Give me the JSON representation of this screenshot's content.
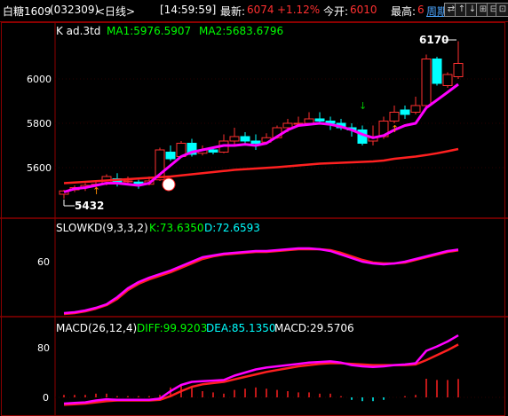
{
  "header": {
    "symbol_name": "白糖1609",
    "symbol_code": "(032309)",
    "period": "<日线>",
    "time": "[14:59:59]",
    "latest_label": "最新:",
    "latest_value": "6074",
    "change_pct": "+1.12%",
    "open_label": "今开:",
    "open_value": "6010",
    "high_label": "最高:",
    "high_value": "6",
    "cycle_link": "周期",
    "buttons": [
      "⇄",
      "↑",
      "↓",
      "⊞",
      "⊟",
      "⊡"
    ]
  },
  "colors": {
    "ma1": "#ff00ff",
    "ma2": "#ff2020",
    "kline_up": "#ff3030",
    "kline_down": "#00ffff",
    "slow_k": "#ff00ff",
    "slow_d": "#ff2020",
    "macd": "#ff00ff",
    "dea": "#ff2020",
    "grid": "#8b0000"
  },
  "chart_data": [
    {
      "type": "candlestick",
      "title": "K  ad.3td",
      "indicators": [
        {
          "name": "MA1",
          "value": "5976.5907"
        },
        {
          "name": "MA2",
          "value": "5683.6796"
        }
      ],
      "yticks": [
        "6000",
        "5800",
        "5600"
      ],
      "ylim": [
        5400,
        6220
      ],
      "annotations": {
        "high": "6170",
        "low": "5432"
      },
      "candles": [
        [
          5480,
          5495,
          5460,
          5500
        ],
        [
          5500,
          5510,
          5490,
          5520
        ],
        [
          5510,
          5520,
          5495,
          5530
        ],
        [
          5520,
          5525,
          5505,
          5540
        ],
        [
          5530,
          5560,
          5520,
          5570
        ],
        [
          5550,
          5530,
          5515,
          5575
        ],
        [
          5540,
          5540,
          5520,
          5560
        ],
        [
          5535,
          5520,
          5505,
          5545
        ],
        [
          5525,
          5540,
          5520,
          5560
        ],
        [
          5545,
          5680,
          5540,
          5690
        ],
        [
          5670,
          5640,
          5630,
          5700
        ],
        [
          5650,
          5710,
          5645,
          5720
        ],
        [
          5710,
          5660,
          5650,
          5730
        ],
        [
          5665,
          5680,
          5655,
          5700
        ],
        [
          5680,
          5670,
          5660,
          5690
        ],
        [
          5670,
          5720,
          5665,
          5750
        ],
        [
          5720,
          5740,
          5700,
          5780
        ],
        [
          5740,
          5720,
          5710,
          5760
        ],
        [
          5720,
          5710,
          5680,
          5750
        ],
        [
          5715,
          5735,
          5705,
          5755
        ],
        [
          5735,
          5780,
          5730,
          5790
        ],
        [
          5780,
          5800,
          5760,
          5820
        ],
        [
          5800,
          5800,
          5790,
          5830
        ],
        [
          5800,
          5820,
          5790,
          5850
        ],
        [
          5820,
          5810,
          5800,
          5850
        ],
        [
          5810,
          5800,
          5770,
          5830
        ],
        [
          5800,
          5780,
          5770,
          5820
        ],
        [
          5780,
          5770,
          5740,
          5800
        ],
        [
          5770,
          5710,
          5700,
          5790
        ],
        [
          5720,
          5740,
          5700,
          5790
        ],
        [
          5740,
          5810,
          5730,
          5830
        ],
        [
          5810,
          5850,
          5800,
          5880
        ],
        [
          5860,
          5840,
          5820,
          5880
        ],
        [
          5850,
          5880,
          5840,
          5920
        ],
        [
          5880,
          6090,
          5870,
          6110
        ],
        [
          6090,
          5980,
          5970,
          6100
        ],
        [
          5970,
          6020,
          5960,
          6030
        ],
        [
          6010,
          6070,
          6000,
          6170
        ]
      ],
      "ma1": [
        5490,
        5505,
        5510,
        5520,
        5530,
        5530,
        5525,
        5520,
        5530,
        5570,
        5610,
        5650,
        5670,
        5680,
        5690,
        5700,
        5700,
        5705,
        5700,
        5710,
        5740,
        5770,
        5790,
        5795,
        5800,
        5795,
        5785,
        5770,
        5750,
        5735,
        5745,
        5770,
        5790,
        5800,
        5870,
        5905,
        5940,
        5976
      ],
      "ma2": [
        5530,
        5533,
        5536,
        5539,
        5542,
        5545,
        5548,
        5551,
        5554,
        5557,
        5560,
        5565,
        5570,
        5575,
        5580,
        5585,
        5590,
        5593,
        5596,
        5599,
        5602,
        5606,
        5610,
        5614,
        5618,
        5620,
        5622,
        5624,
        5626,
        5628,
        5632,
        5640,
        5645,
        5650,
        5657,
        5665,
        5674,
        5684
      ]
    },
    {
      "type": "line",
      "title": "SLOWKD(9,3,3,2)",
      "indicators": [
        {
          "name": "K",
          "value": "73.6350"
        },
        {
          "name": "D",
          "value": "72.6593"
        }
      ],
      "yticks": [
        "60"
      ],
      "ylim": [
        0,
        85
      ],
      "series": [
        {
          "name": "K",
          "values": [
            2,
            3,
            5,
            8,
            12,
            20,
            30,
            37,
            42,
            46,
            50,
            55,
            60,
            65,
            67,
            69,
            70,
            71,
            72,
            72,
            73,
            74,
            75,
            75,
            74,
            72,
            68,
            64,
            60,
            58,
            57,
            58,
            60,
            63,
            66,
            69,
            72,
            73.6
          ]
        },
        {
          "name": "D",
          "values": [
            1,
            2,
            4,
            7,
            11,
            18,
            28,
            35,
            40,
            44,
            48,
            53,
            58,
            63,
            66,
            68,
            69,
            70,
            71,
            71,
            72,
            73,
            74,
            74,
            74,
            73,
            70,
            66,
            62,
            59,
            58,
            58,
            59,
            62,
            65,
            68,
            71,
            72.7
          ]
        }
      ]
    },
    {
      "type": "line",
      "title": "MACD(26,12,4)",
      "indicators": [
        {
          "name": "DIFF",
          "value": "99.9203"
        },
        {
          "name": "DEA",
          "value": "85.1350"
        },
        {
          "name": "MACD",
          "value": "29.5706"
        }
      ],
      "yticks": [
        "80",
        "0"
      ],
      "ylim": [
        -18,
        125
      ],
      "series": [
        {
          "name": "DIFF",
          "values": [
            -10,
            -9,
            -8,
            -5,
            -3,
            -4,
            -4,
            -4,
            -4,
            -2,
            10,
            20,
            25,
            26,
            27,
            28,
            35,
            40,
            45,
            48,
            50,
            52,
            54,
            56,
            57,
            58,
            56,
            52,
            50,
            49,
            50,
            52,
            53,
            55,
            75,
            82,
            90,
            99.9
          ]
        },
        {
          "name": "DEA",
          "values": [
            -12,
            -11,
            -10,
            -8,
            -6,
            -5,
            -5,
            -5,
            -5,
            -4,
            2,
            10,
            17,
            21,
            23,
            25,
            29,
            33,
            37,
            41,
            44,
            47,
            50,
            52,
            54,
            55,
            55,
            54,
            53,
            52,
            52,
            52,
            52,
            53,
            60,
            68,
            76,
            85.1
          ]
        },
        {
          "name": "MACD",
          "values": [
            4,
            4,
            4,
            6,
            6,
            2,
            2,
            2,
            2,
            4,
            16,
            20,
            16,
            10,
            8,
            6,
            12,
            14,
            16,
            14,
            12,
            10,
            8,
            8,
            6,
            6,
            2,
            -4,
            -6,
            -6,
            -4,
            0,
            2,
            4,
            30,
            28,
            28,
            29.6
          ]
        }
      ]
    }
  ]
}
